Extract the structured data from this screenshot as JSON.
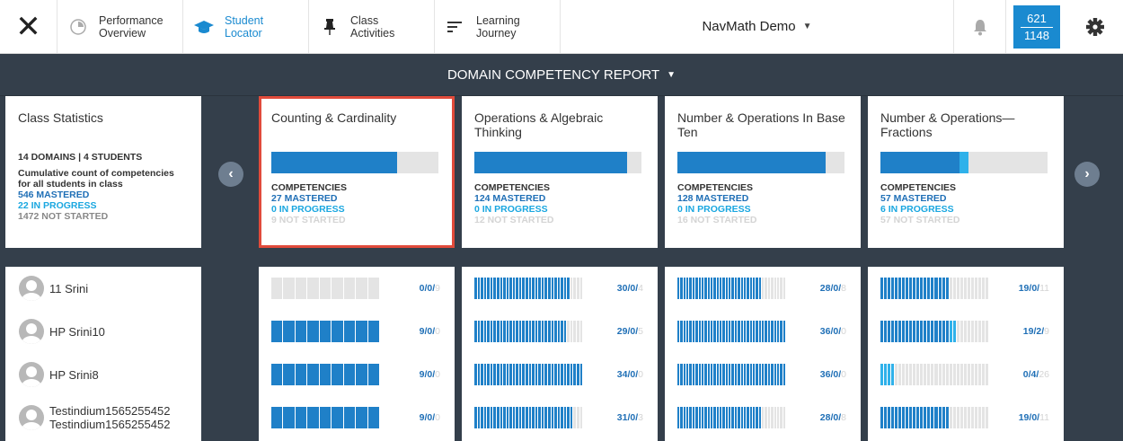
{
  "nav": {
    "close": "✕",
    "items": [
      {
        "label": "Performance Overview",
        "icon": "performance-icon",
        "active": false
      },
      {
        "label": "Student Locator",
        "icon": "graduation-cap-icon",
        "active": true
      },
      {
        "label": "Class Activities",
        "icon": "pin-icon",
        "active": false
      },
      {
        "label": "Learning Journey",
        "icon": "journey-icon",
        "active": false
      }
    ],
    "course": "NavMath Demo",
    "score_top": "621",
    "score_bottom": "1148"
  },
  "report": {
    "title": "DOMAIN COMPETENCY REPORT"
  },
  "stats": {
    "title": "Class Statistics",
    "domains": "14 DOMAINS | 4 STUDENTS",
    "desc1": "Cumulative count of competencies",
    "desc2": "for all students in class",
    "mastered": "546 MASTERED",
    "in_progress": "22 IN PROGRESS",
    "not_started": "1472 NOT STARTED"
  },
  "domains": [
    {
      "title": "Counting & Cardinality",
      "label": "COMPETENCIES",
      "mastered": "27 MASTERED",
      "in_progress": "0 IN PROGRESS",
      "not_started": "9 NOT STARTED",
      "m": 27,
      "p": 0,
      "n": 9,
      "selected": true
    },
    {
      "title": "Operations & Algebraic Thinking",
      "label": "COMPETENCIES",
      "mastered": "124 MASTERED",
      "in_progress": "0 IN PROGRESS",
      "not_started": "12 NOT STARTED",
      "m": 124,
      "p": 0,
      "n": 12,
      "selected": false
    },
    {
      "title": "Number & Operations In Base Ten",
      "label": "COMPETENCIES",
      "mastered": "128 MASTERED",
      "in_progress": "0 IN PROGRESS",
      "not_started": "16 NOT STARTED",
      "m": 128,
      "p": 0,
      "n": 16,
      "selected": false
    },
    {
      "title": "Number & Operations—Fractions",
      "label": "COMPETENCIES",
      "mastered": "57 MASTERED",
      "in_progress": "6 IN PROGRESS",
      "not_started": "57 NOT STARTED",
      "m": 57,
      "p": 6,
      "n": 57,
      "selected": false
    }
  ],
  "students": [
    {
      "name": "11 Srini",
      "scores": [
        {
          "m": 0,
          "p": 0,
          "n": 9
        },
        {
          "m": 30,
          "p": 0,
          "n": 4
        },
        {
          "m": 28,
          "p": 0,
          "n": 8
        },
        {
          "m": 19,
          "p": 0,
          "n": 11
        }
      ]
    },
    {
      "name": "HP Srini10",
      "scores": [
        {
          "m": 9,
          "p": 0,
          "n": 0
        },
        {
          "m": 29,
          "p": 0,
          "n": 5
        },
        {
          "m": 36,
          "p": 0,
          "n": 0
        },
        {
          "m": 19,
          "p": 2,
          "n": 9
        }
      ]
    },
    {
      "name": "HP Srini8",
      "scores": [
        {
          "m": 9,
          "p": 0,
          "n": 0
        },
        {
          "m": 34,
          "p": 0,
          "n": 0
        },
        {
          "m": 36,
          "p": 0,
          "n": 0
        },
        {
          "m": 0,
          "p": 4,
          "n": 26
        }
      ]
    },
    {
      "name": "Testindium1565255452 Testindium1565255452",
      "scores": [
        {
          "m": 9,
          "p": 0,
          "n": 0
        },
        {
          "m": 31,
          "p": 0,
          "n": 3
        },
        {
          "m": 28,
          "p": 0,
          "n": 8
        },
        {
          "m": 19,
          "p": 0,
          "n": 11
        }
      ]
    }
  ]
}
